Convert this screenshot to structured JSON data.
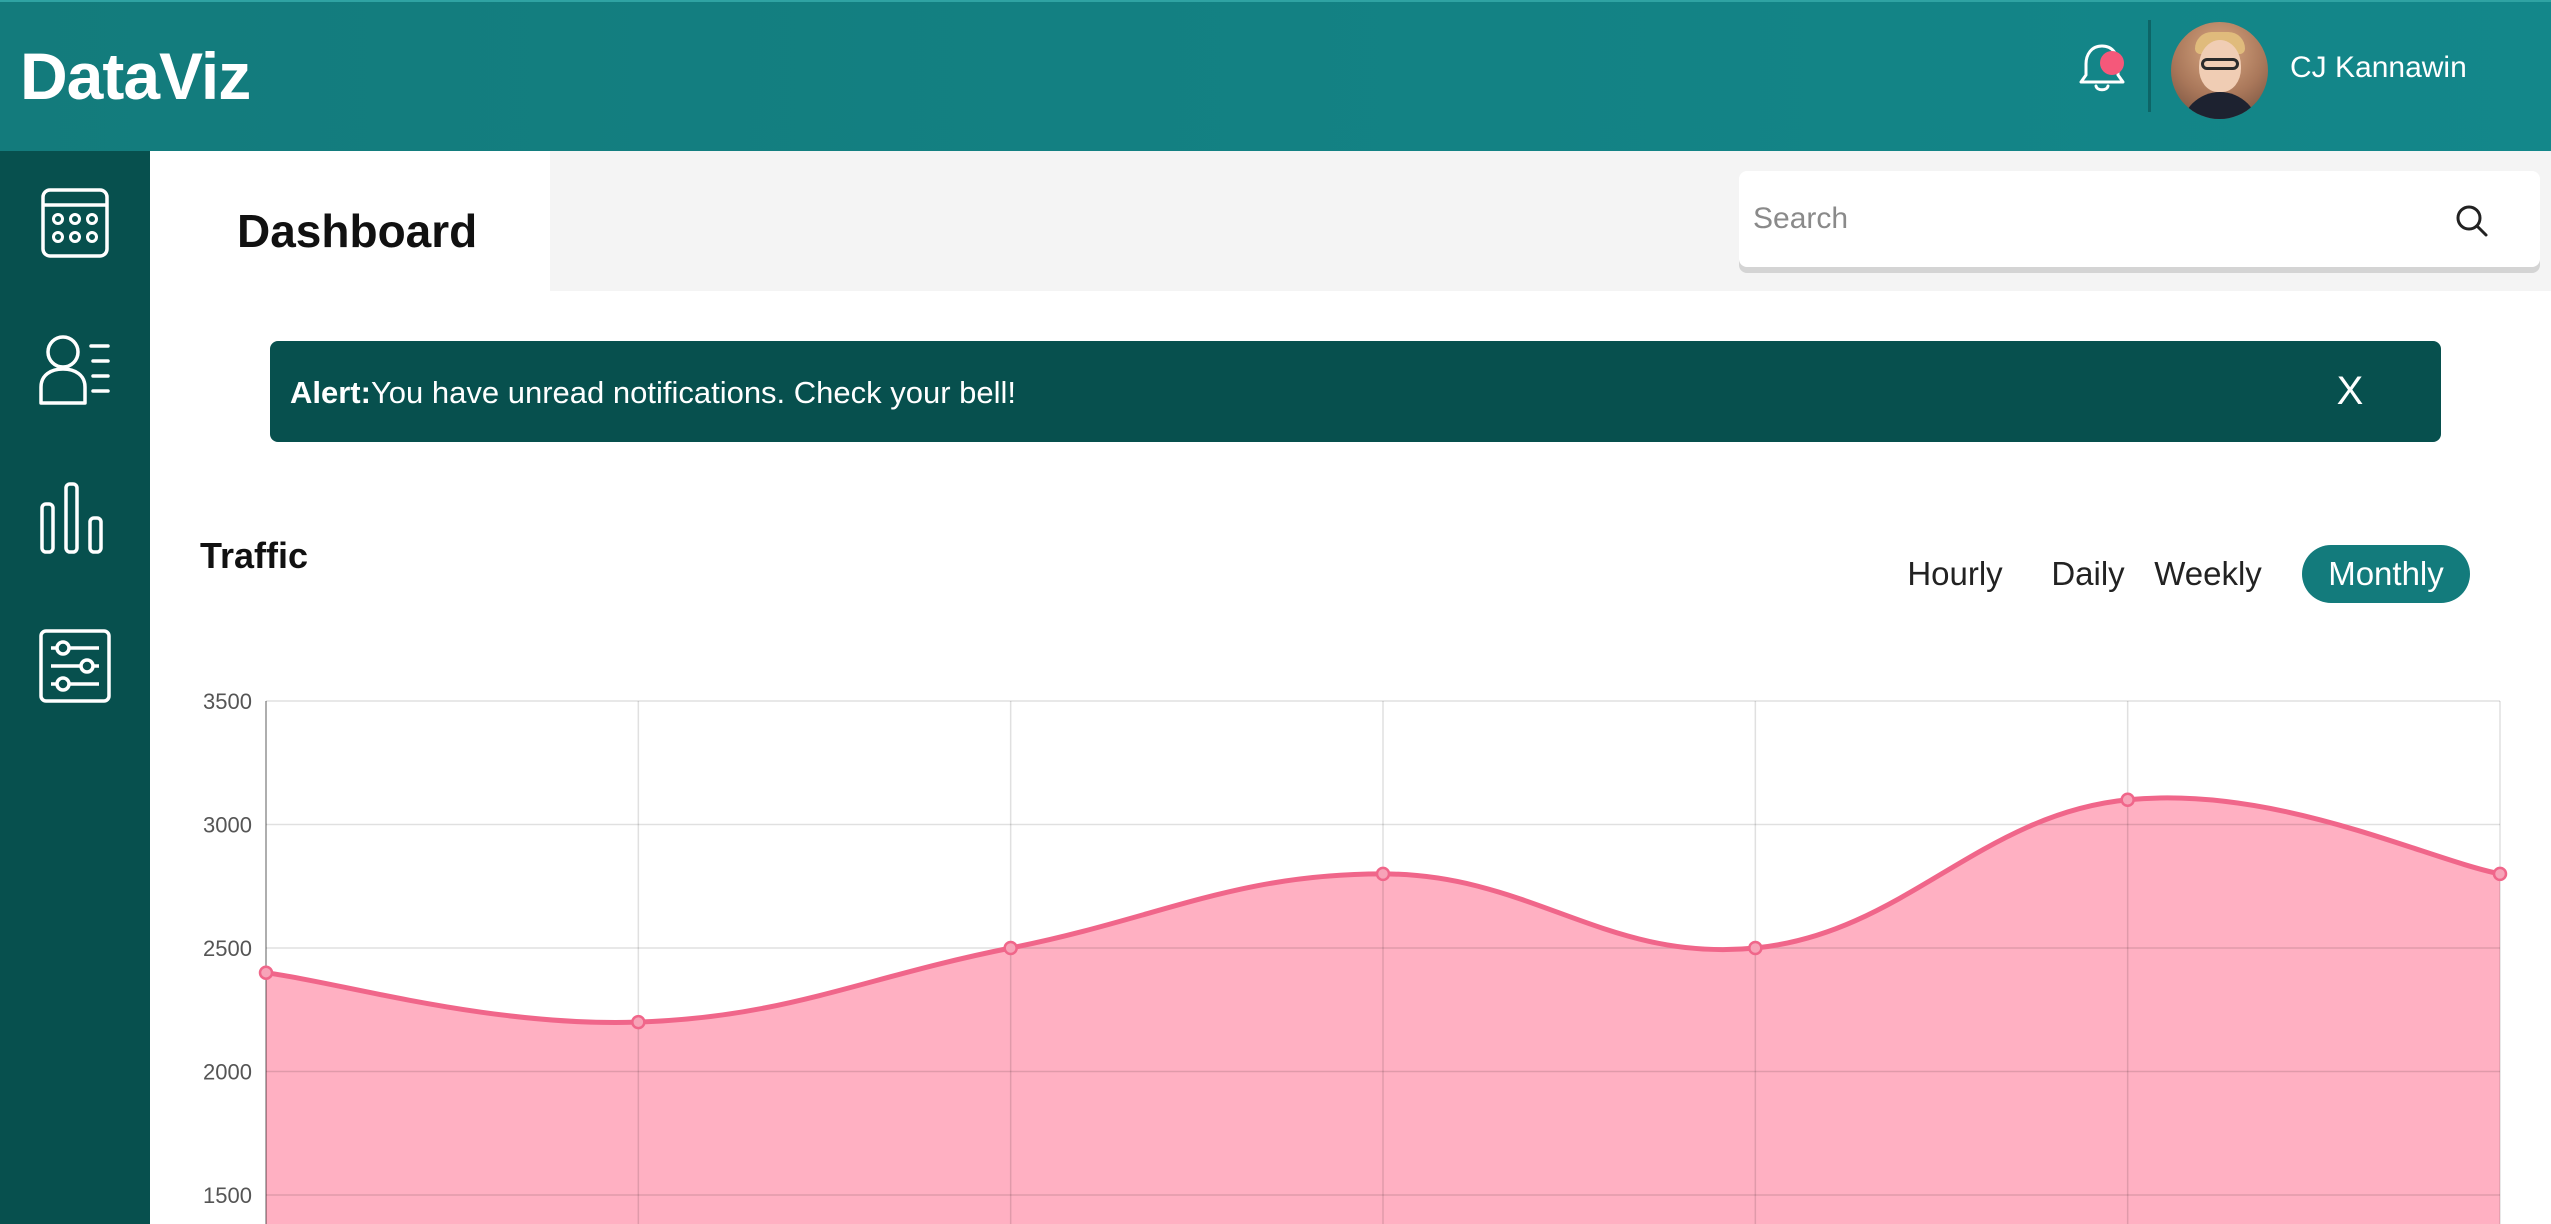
{
  "header": {
    "brand": "DataViz",
    "user_name": "CJ Kannawin",
    "bell_icon": "bell-icon",
    "notification_dot_color": "#f5587a"
  },
  "sidebar": {
    "items": [
      {
        "icon": "calendar-icon"
      },
      {
        "icon": "user-list-icon"
      },
      {
        "icon": "bar-chart-icon"
      },
      {
        "icon": "sliders-icon"
      }
    ]
  },
  "topbar": {
    "active_tab": "Dashboard",
    "search": {
      "placeholder": "Search",
      "value": "",
      "icon": "search-icon"
    }
  },
  "alert": {
    "label": "Alert:",
    "message": "You have unread notifications. Check your bell!",
    "close_label": "X"
  },
  "traffic": {
    "title": "Traffic",
    "periods": [
      "Hourly",
      "Daily",
      "Weekly",
      "Monthly"
    ],
    "selected_period": "Monthly"
  },
  "colors": {
    "header": "#137b7c",
    "sidebar": "#07504e",
    "alert": "#07504e",
    "accent": "#137b7c",
    "series_line": "#f0668a",
    "series_fill": "#ffb0c2"
  },
  "chart_data": {
    "type": "area",
    "x": [
      0,
      1,
      2,
      3,
      4,
      5,
      6
    ],
    "series": [
      {
        "values": [
          2400,
          2200,
          2500,
          2800,
          2500,
          3100,
          2800
        ]
      }
    ],
    "y_ticks": [
      3500,
      3000,
      2500,
      2000,
      1500
    ],
    "ylim": [
      1500,
      3500
    ],
    "xlabel": "",
    "ylabel": "",
    "grid": true,
    "smooth": true
  }
}
